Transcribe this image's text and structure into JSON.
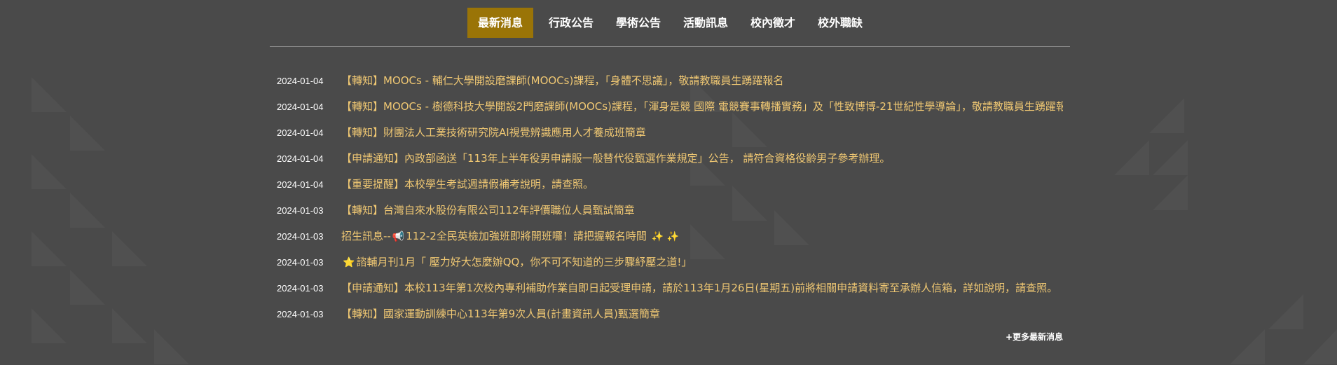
{
  "tabs": [
    {
      "label": "最新消息",
      "active": true
    },
    {
      "label": "行政公告",
      "active": false
    },
    {
      "label": "學術公告",
      "active": false
    },
    {
      "label": "活動訊息",
      "active": false
    },
    {
      "label": "校內徵才",
      "active": false
    },
    {
      "label": "校外職缺",
      "active": false
    }
  ],
  "news": [
    {
      "date": "2024-01-04",
      "title": "【轉知】MOOCs - 輔仁大學開設磨課師(MOOCs)課程，「身體不思議」，敬請教職員生踴躍報名"
    },
    {
      "date": "2024-01-04",
      "title": "【轉知】MOOCs - 樹德科技大學開設2門磨課師(MOOCs)課程，「渾身是競 國際 電競賽事轉播實務」及「性致博博-21世紀性學導論」，敬請教職員生踴躍報名"
    },
    {
      "date": "2024-01-04",
      "title": "【轉知】財團法人工業技術研究院AI視覺辨識應用人才養成班簡章"
    },
    {
      "date": "2024-01-04",
      "title": "【申請通知】內政部函送「113年上半年役男申請服一般替代役甄選作業規定」公告， 請符合資格役齡男子參考辦理。"
    },
    {
      "date": "2024-01-04",
      "title": "【重要提醒】本校學生考試週請假補考說明，請查照。"
    },
    {
      "date": "2024-01-03",
      "title": "【轉知】台灣自來水股份有限公司112年評價職位人員甄試簡章"
    },
    {
      "date": "2024-01-03",
      "prefix": "招生訊息--",
      "emoji_before": "📢",
      "title": "112-2全民英檢加強班即將開班囉！請把握報名時間",
      "emoji_after": "✨ ✨"
    },
    {
      "date": "2024-01-03",
      "emoji_before": "⭐",
      "title": "諮輔月刊1月「 壓力好大怎麼辦QQ，你不可不知道的三步驟紓壓之道!」"
    },
    {
      "date": "2024-01-03",
      "title": "【申請通知】本校113年第1次校內專利補助作業自即日起受理申請，請於113年1月26日(星期五)前將相關申請資料寄至承辦人信箱，詳如說明，請查照。"
    },
    {
      "date": "2024-01-03",
      "title": "【轉知】國家運動訓練中心113年第9次人員(計畫資訊人員)甄選簡章"
    }
  ],
  "more_link": "+更多最新消息"
}
